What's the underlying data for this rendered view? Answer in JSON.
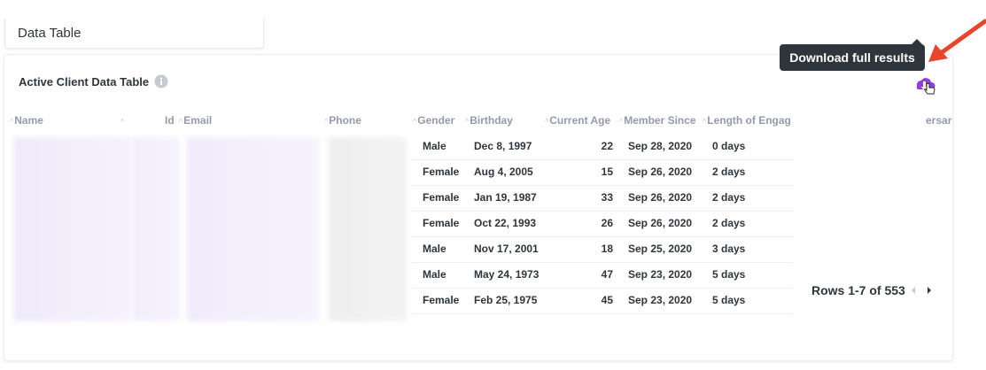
{
  "tab": {
    "title": "Data Table"
  },
  "card": {
    "title": "Active Client Data Table"
  },
  "tooltip": {
    "text": "Download full results"
  },
  "columns": [
    "Name",
    "Id",
    "Email",
    "Phone",
    "Gender",
    "Birthday",
    "Current Age",
    "Member Since",
    "Length of Engag",
    "ersar"
  ],
  "rows": [
    {
      "gender": "Male",
      "birthday": "Dec 8, 1997",
      "age": "22",
      "member_since": "Sep 28, 2020",
      "length": "0 days"
    },
    {
      "gender": "Female",
      "birthday": "Aug 4, 2005",
      "age": "15",
      "member_since": "Sep 26, 2020",
      "length": "2 days"
    },
    {
      "gender": "Female",
      "birthday": "Jan 19, 1987",
      "age": "33",
      "member_since": "Sep 26, 2020",
      "length": "2 days"
    },
    {
      "gender": "Female",
      "birthday": "Oct 22, 1993",
      "age": "26",
      "member_since": "Sep 26, 2020",
      "length": "2 days"
    },
    {
      "gender": "Male",
      "birthday": "Nov 17, 2001",
      "age": "18",
      "member_since": "Sep 25, 2020",
      "length": "3 days"
    },
    {
      "gender": "Male",
      "birthday": "May 24, 1973",
      "age": "47",
      "member_since": "Sep 23, 2020",
      "length": "5 days"
    },
    {
      "gender": "Female",
      "birthday": "Feb 25, 1975",
      "age": "45",
      "member_since": "Sep 23, 2020",
      "length": "5 days"
    }
  ],
  "pagination": {
    "text": "Rows 1-7 of 553"
  },
  "colors": {
    "accent": "#8c3fd9",
    "tooltip_bg": "#2e353b",
    "annotation_arrow": "#e8452c"
  },
  "icons": {
    "info": "info-icon",
    "download": "cloud-download-icon",
    "cursor": "hand-pointer-icon",
    "prev": "chevron-left-icon",
    "next": "chevron-right-icon"
  }
}
